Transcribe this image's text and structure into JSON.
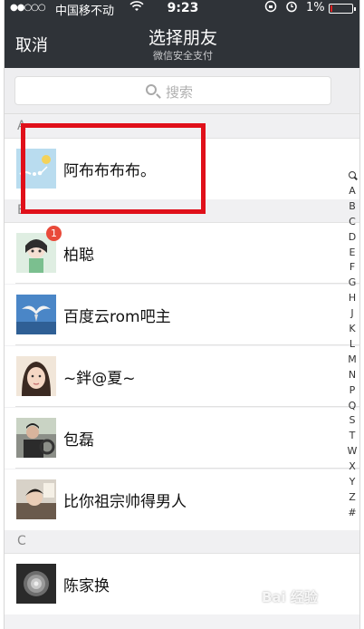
{
  "status_bar": {
    "signal": "●●○○○",
    "carrier": "中国移不动",
    "time": "9:23",
    "battery_percent": "1%",
    "battery_level": 0.01
  },
  "nav": {
    "cancel_label": "取消",
    "title": "选择朋友",
    "subtitle": "微信安全支付"
  },
  "search": {
    "placeholder": "搜索"
  },
  "sections": [
    {
      "letter": "A",
      "contacts": [
        {
          "name": "阿布布布布。",
          "avatar": "bird-avatar"
        }
      ]
    },
    {
      "letter": "B",
      "contacts": [
        {
          "name": "柏聪",
          "avatar": "anime-girl-avatar",
          "badge": "1"
        },
        {
          "name": "百度云rom吧主",
          "avatar": "seagull-avatar"
        },
        {
          "name": "~鉡@夏~",
          "avatar": "girl-portrait-avatar"
        },
        {
          "name": "包磊",
          "avatar": "driver-avatar"
        },
        {
          "name": "比你祖宗帅得男人",
          "avatar": "dark-portrait-avatar"
        }
      ]
    },
    {
      "letter": "C",
      "contacts": [
        {
          "name": "陈家换",
          "avatar": "flower-avatar"
        }
      ]
    }
  ],
  "index_letters": [
    "A",
    "B",
    "C",
    "D",
    "E",
    "F",
    "G",
    "H",
    "J",
    "K",
    "L",
    "M",
    "N",
    "P",
    "Q",
    "S",
    "T",
    "W",
    "X",
    "Y",
    "Z",
    "#"
  ],
  "watermark": "Bai 经验",
  "colors": {
    "nav_bar": "#2f3338",
    "highlight": "#e0101a",
    "badge": "#e94a3a"
  }
}
